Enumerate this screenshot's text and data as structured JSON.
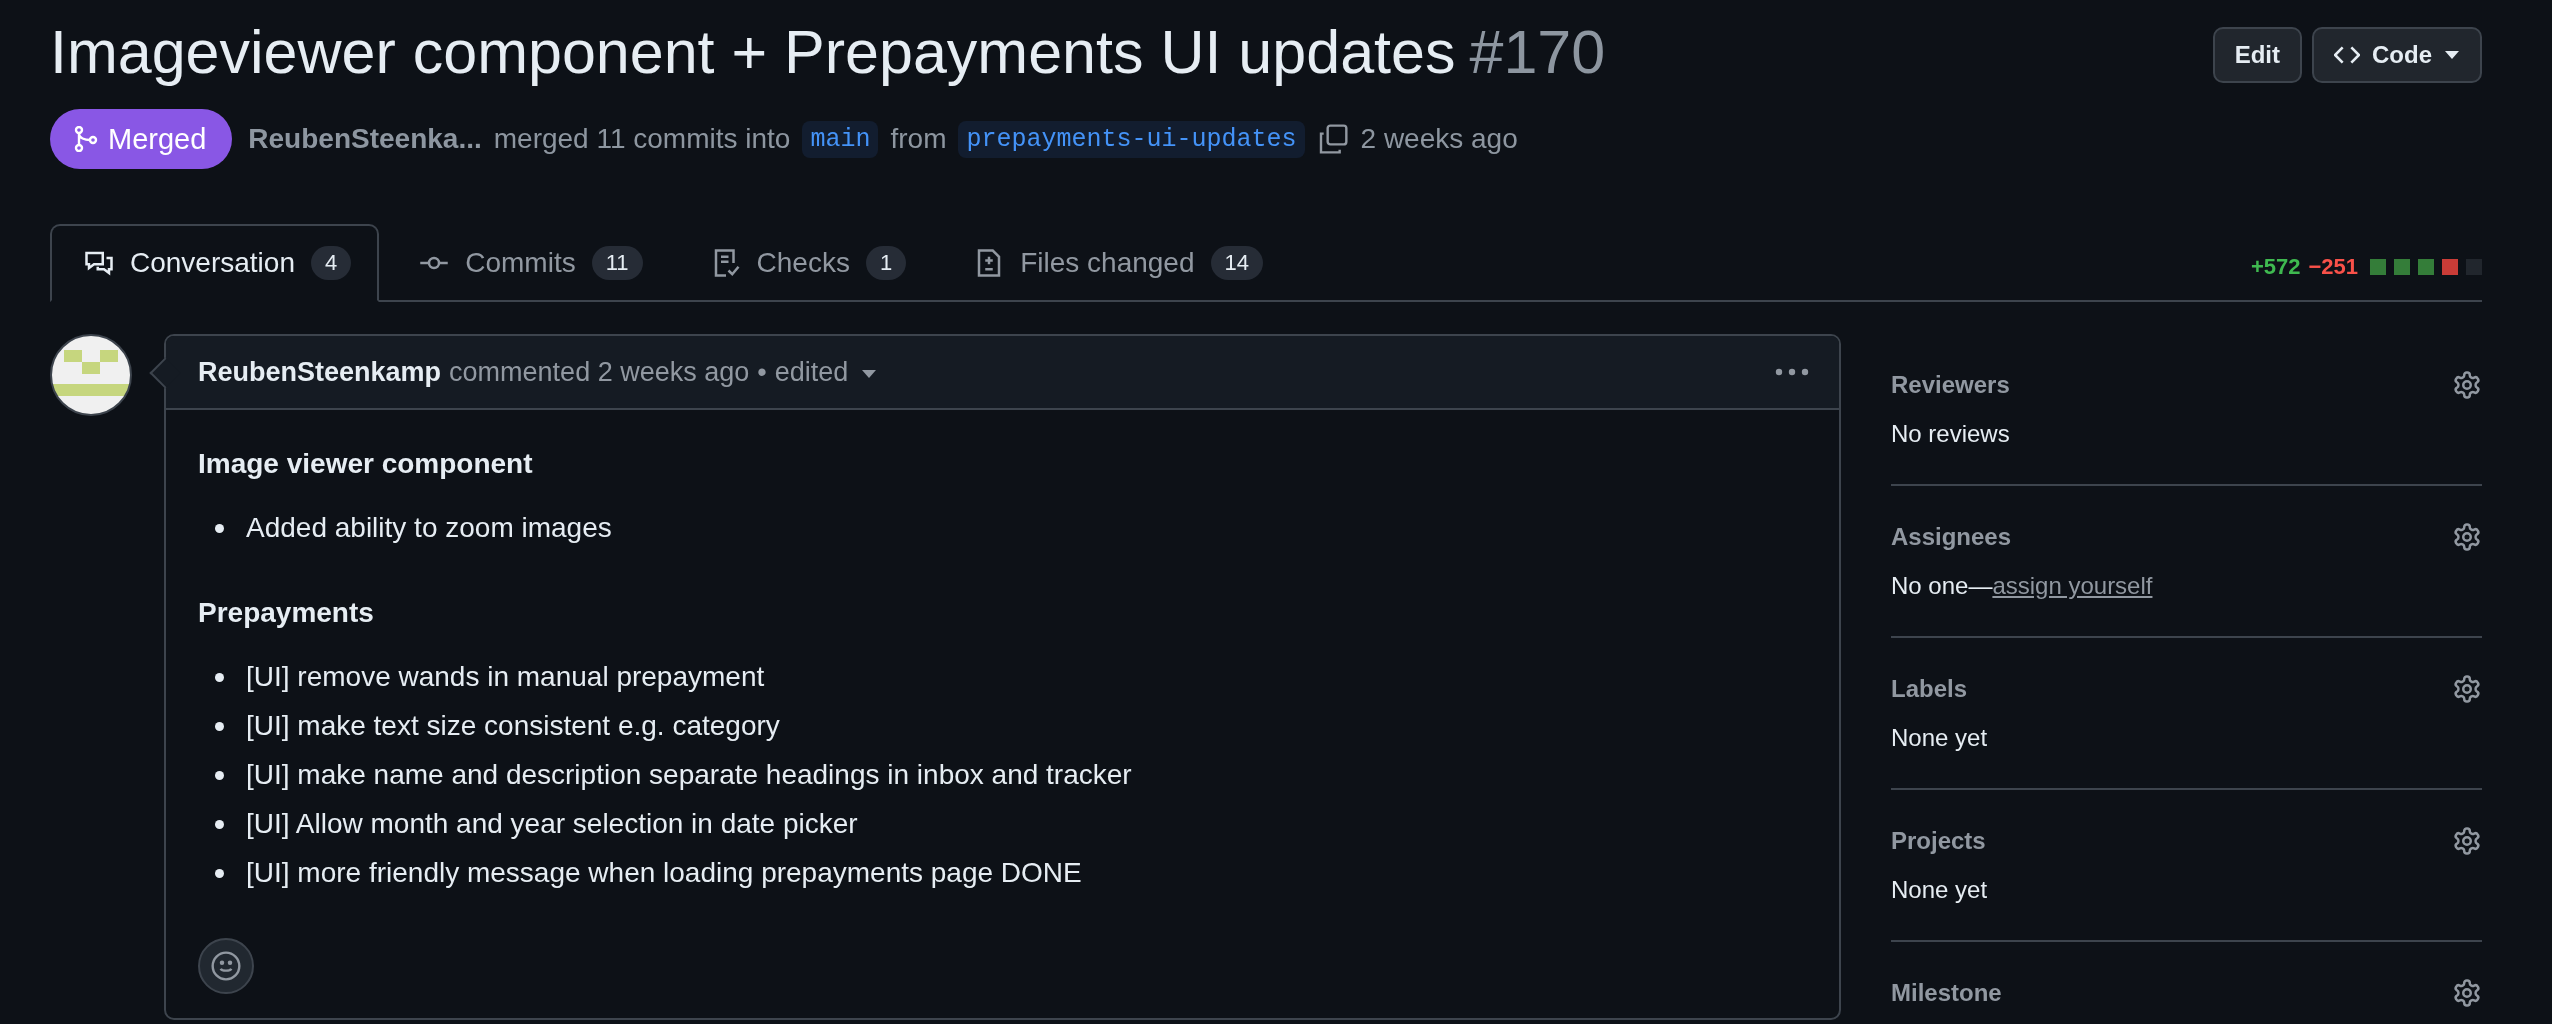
{
  "title": {
    "text": "Imageviewer component + Prepayments UI updates",
    "number": "#170"
  },
  "actions": [
    {
      "label": "Edit",
      "kind": "plain"
    },
    {
      "label": "Code",
      "kind": "code"
    }
  ],
  "status": {
    "label": "Merged"
  },
  "meta": {
    "author": "ReubenSteenka...",
    "text": "merged 11 commits into",
    "base": "main",
    "from": "from",
    "head": "prepayments-ui-updates",
    "time": "2 weeks ago"
  },
  "tabs": [
    {
      "label": "Conversation",
      "count": "4",
      "selected": true
    },
    {
      "label": "Commits",
      "count": "11",
      "selected": false
    },
    {
      "label": "Checks",
      "count": "1",
      "selected": false
    },
    {
      "label": "Files changed",
      "count": "14",
      "selected": false
    }
  ],
  "diffstat": {
    "additions": "+572",
    "deletions": "−251",
    "blocks": [
      {
        "color": "#347d39"
      },
      {
        "color": "#347d39"
      },
      {
        "color": "#347d39"
      },
      {
        "color": "#c93c37"
      },
      {
        "color": "#21262d"
      }
    ]
  },
  "comment": {
    "author": "ReubenSteenkamp",
    "action": "commented 2 weeks ago",
    "separator": "•",
    "edited": "edited",
    "body": [
      {
        "kind": "heading",
        "text": "Image viewer component"
      },
      {
        "kind": "list",
        "items": [
          "Added ability to zoom images"
        ]
      },
      {
        "kind": "heading",
        "text": "Prepayments"
      },
      {
        "kind": "list",
        "items": [
          "[UI] remove wands in manual prepayment",
          "[UI] make text size consistent e.g. category",
          "[UI] make name and description separate headings in inbox and tracker",
          "[UI] Allow month and year selection in date picker",
          "[UI] more friendly message when loading prepayments page DONE"
        ]
      }
    ]
  },
  "sidebar": [
    {
      "title": "Reviewers",
      "value": "No reviews"
    },
    {
      "title": "Assignees",
      "value": "No one—",
      "link": "assign yourself"
    },
    {
      "title": "Labels",
      "value": "None yet"
    },
    {
      "title": "Projects",
      "value": "None yet"
    },
    {
      "title": "Milestone"
    }
  ]
}
